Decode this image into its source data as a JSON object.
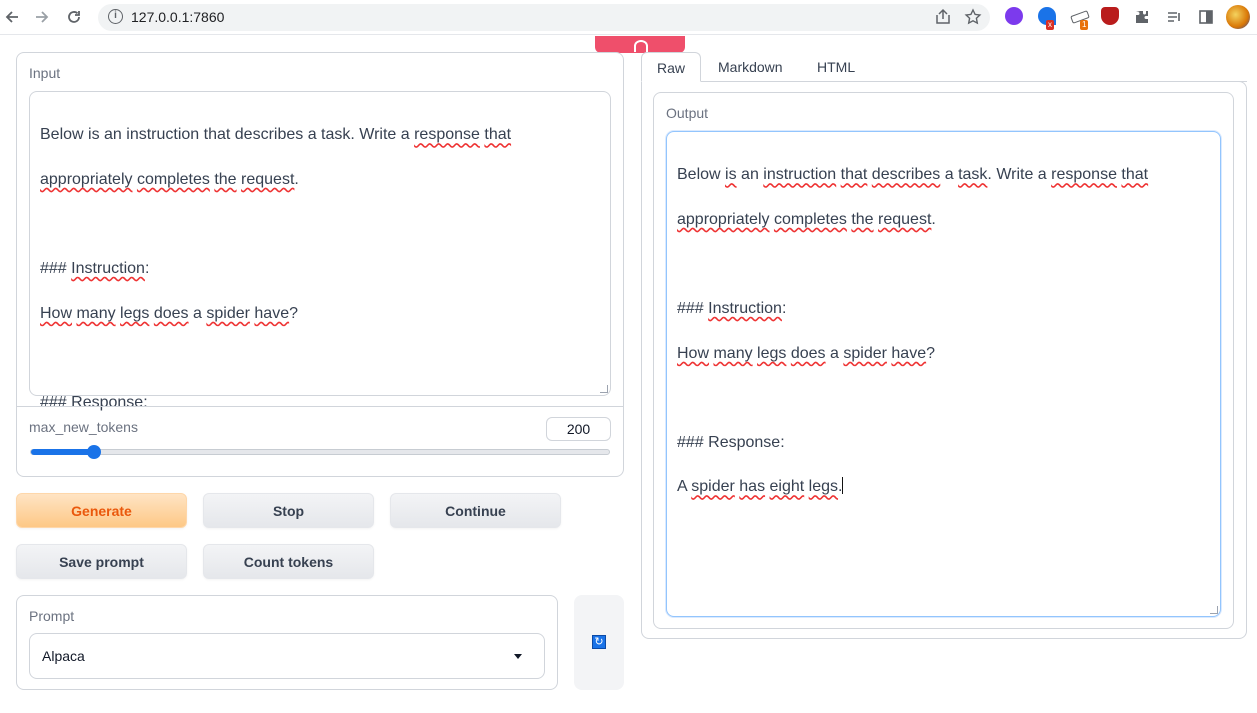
{
  "browser": {
    "url": "127.0.0.1:7860",
    "icons": [
      "back-icon",
      "forward-icon",
      "reload-icon",
      "site-info-icon",
      "share-icon",
      "star-icon",
      "extensions-icon",
      "reading-list-icon",
      "side-panel-icon",
      "profile-avatar"
    ],
    "ext_badges": {
      "red": "x",
      "orange": "1"
    }
  },
  "input_panel": {
    "label": "Input",
    "text_lines": [
      "Below is an instruction that describes a task. Write a response that",
      "appropriately completes the request.",
      "",
      "### Instruction:",
      "How many legs does a spider have?",
      "",
      "### Response:"
    ]
  },
  "slider": {
    "label": "max_new_tokens",
    "value": "200",
    "fraction": 0.11
  },
  "buttons": {
    "generate": "Generate",
    "stop": "Stop",
    "continue": "Continue",
    "save_prompt": "Save prompt",
    "count_tokens": "Count tokens"
  },
  "prompt": {
    "label": "Prompt",
    "selected": "Alpaca"
  },
  "tabs": {
    "raw": "Raw",
    "markdown": "Markdown",
    "html": "HTML"
  },
  "output_panel": {
    "label": "Output",
    "text_lines": [
      "Below is an instruction that describes a task. Write a response that",
      "appropriately completes the request.",
      "",
      "### Instruction:",
      "How many legs does a spider have?",
      "",
      "### Response:",
      "A spider has eight legs."
    ]
  },
  "colors": {
    "accent_blue": "#1a73e8",
    "generate_text": "#ea580c",
    "handle_red": "#ef4f6b"
  }
}
